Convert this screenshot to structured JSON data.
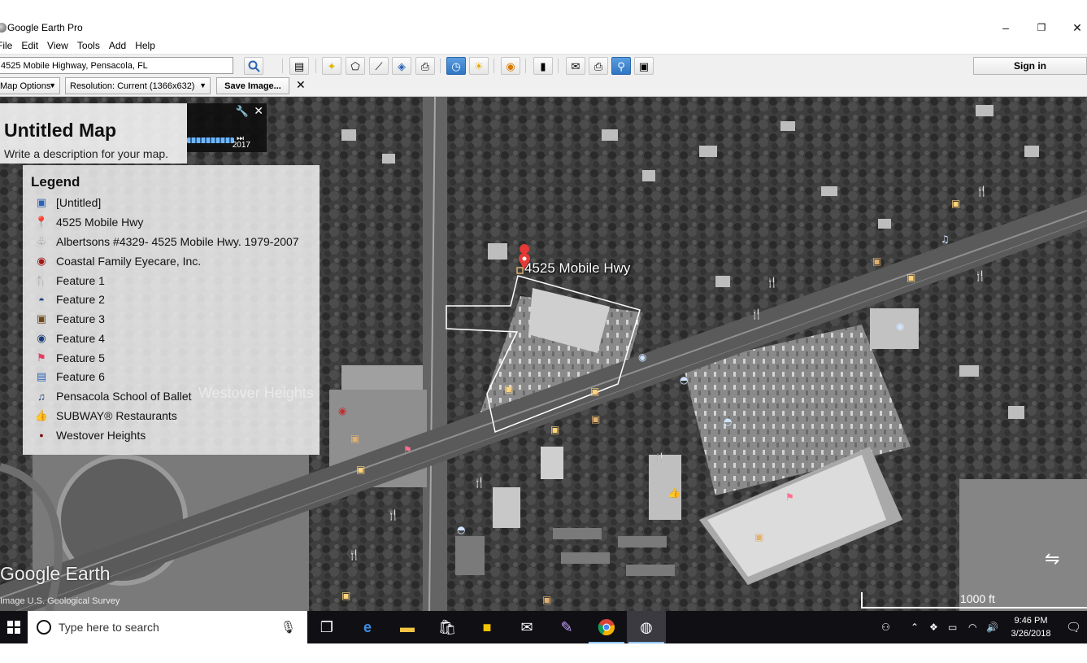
{
  "window": {
    "title": "Google Earth Pro",
    "controls": [
      "–",
      "❐",
      "✕"
    ]
  },
  "menu": [
    "File",
    "Edit",
    "View",
    "Tools",
    "Add",
    "Help"
  ],
  "toolbar": {
    "search_value": "4525 Mobile Highway, Pensacola, FL",
    "sign_in": "Sign in"
  },
  "image_options": {
    "map_options": "Map Options",
    "resolution": "Resolution: Current (1366x632)",
    "save_image": "Save Image...",
    "close": "✕"
  },
  "time_slider": {
    "year": "2017"
  },
  "map_info": {
    "title": "Untitled Map",
    "description": "Write a description for your map."
  },
  "legend": {
    "title": "Legend",
    "items": [
      {
        "label": "[Untitled]",
        "icon": "image-overlay-icon"
      },
      {
        "label": "4525 Mobile Hwy",
        "icon": "red-pin-icon"
      },
      {
        "label": "Albertsons #4329- 4525 Mobile Hwy. 1979-2007",
        "icon": "grey-shapes-icon"
      },
      {
        "label": "Coastal Family Eyecare, Inc.",
        "icon": "eye-icon"
      },
      {
        "label": "Feature 1",
        "icon": "fork-knife-icon"
      },
      {
        "label": "Feature 2",
        "icon": "shopping-bag-icon"
      },
      {
        "label": "Feature 3",
        "icon": "square-dot-icon"
      },
      {
        "label": "Feature 4",
        "icon": "bus-icon"
      },
      {
        "label": "Feature 5",
        "icon": "pink-flag-icon"
      },
      {
        "label": "Feature 6",
        "icon": "picture-icon"
      },
      {
        "label": "Pensacola School of Ballet",
        "icon": "music-note-icon"
      },
      {
        "label": "SUBWAY® Restaurants",
        "icon": "thumbs-up-icon"
      },
      {
        "label": "Westover Heights",
        "icon": "dark-red-dot-icon"
      }
    ]
  },
  "map": {
    "marker_label": "4525 Mobile Hwy",
    "place_label": "Westover Heights",
    "logo": "Google Earth",
    "credit": "Image U.S. Geological Survey",
    "scale": "1000 ft"
  },
  "taskbar": {
    "search_placeholder": "Type here to search",
    "time": "9:46 PM",
    "date": "3/26/2018"
  }
}
